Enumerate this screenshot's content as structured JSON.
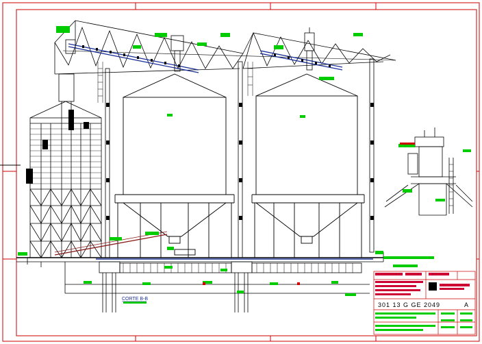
{
  "section_label": "CORTE B-B",
  "title_block": {
    "drawing_number": "301  13  G  GE  2049",
    "revision": "A"
  },
  "colors": {
    "frame": "#cc0000",
    "linework": "#000000",
    "annotation": "#00cc00",
    "conveyor": "#1a2f9a",
    "slope_pipe": "#8b1a1a",
    "title_text": "#cc0033"
  }
}
